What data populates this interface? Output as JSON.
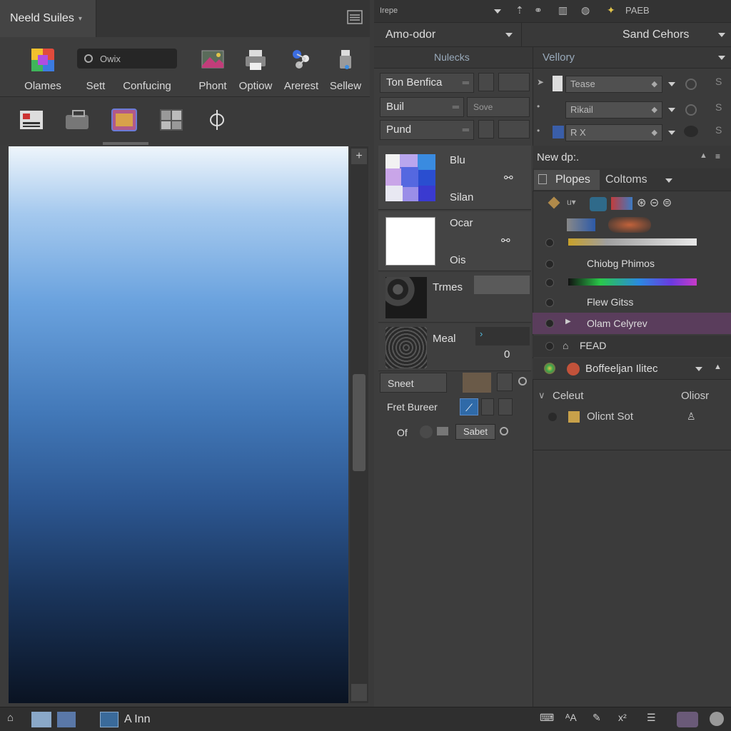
{
  "window": {
    "doc_tab": "Neeld Suiles",
    "combo_label": "Owix"
  },
  "toolbar": {
    "tools": [
      {
        "label": "Olames",
        "icon": "color-palette-icon"
      },
      {
        "label": "Sett",
        "icon": "camera-icon"
      },
      {
        "label": "Confucing",
        "icon": ""
      },
      {
        "label": "Phont",
        "icon": "photo-icon"
      },
      {
        "label": "Optiow",
        "icon": "print-icon"
      },
      {
        "label": "Arerest",
        "icon": "molecule-icon"
      },
      {
        "label": "Sellew",
        "icon": "spray-icon"
      }
    ],
    "secondary_tools": [
      "sliders-icon",
      "briefcase-icon",
      "screen-icon",
      "grid-icon",
      "phi-icon"
    ]
  },
  "top_right": {
    "small_label": "Irepe",
    "icons_label": "PAEB",
    "dropdown_left": "Amo-odor",
    "dropdown_right": "Sand Cehors",
    "tab_left": "Nulecks",
    "tab_right": "Vellory"
  },
  "mid": {
    "fields": [
      {
        "label": "Ton Benfica"
      },
      {
        "label": "Buil",
        "value": "Sove"
      },
      {
        "label": "Pund"
      }
    ],
    "swatches": [
      {
        "top": "Blu",
        "bottom": "Silan"
      },
      {
        "top": "Ocar",
        "bottom": "Ois"
      },
      {
        "top": "Trmes",
        "bottom": ""
      },
      {
        "top": "Meal",
        "bottom": "0"
      }
    ],
    "rows": [
      {
        "label": "Sneet"
      },
      {
        "label": "Fret Bureer"
      },
      {
        "label": "Of",
        "button": "Sabet"
      }
    ]
  },
  "right": {
    "inputs": [
      "Tease",
      "Rikail",
      "R X"
    ],
    "section_title": "New dp:.",
    "tabs": [
      "Plopes",
      "Coltoms"
    ],
    "layers": [
      {
        "name": "",
        "type": "icons"
      },
      {
        "name": "",
        "type": "gradient-gold"
      },
      {
        "name": "Chiobg Phimos"
      },
      {
        "name": "",
        "type": "gradient-rainbow"
      },
      {
        "name": "Flew Gitss"
      },
      {
        "name": "Olam Celyrev",
        "selected": true
      },
      {
        "name": "FEAD"
      }
    ],
    "footer_title": "Boffeeljan Ilitec",
    "footer_left": "Celeut",
    "footer_right": "Oliosr",
    "footer_item": "Olicnt Sot"
  },
  "status": {
    "text": "A Inn"
  },
  "colors": {
    "selected_layer": "#5a3d5c",
    "panel": "#3b3b3b",
    "dark": "#2f2f2f"
  }
}
